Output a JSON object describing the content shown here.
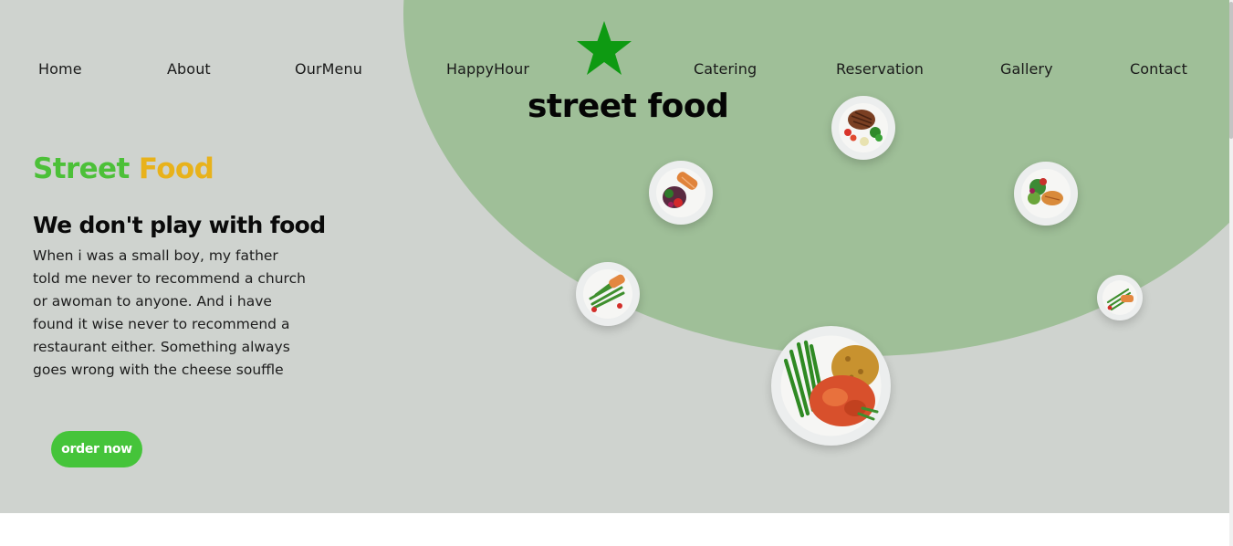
{
  "nav": {
    "items": [
      {
        "label": "Home"
      },
      {
        "label": "About"
      },
      {
        "label": "OurMenu"
      },
      {
        "label": "HappyHour"
      },
      {
        "label": "Catering"
      },
      {
        "label": "Reservation"
      },
      {
        "label": "Gallery"
      },
      {
        "label": "Contact"
      }
    ]
  },
  "brand": {
    "name": "street food",
    "logo_icon": "star-icon",
    "logo_color": "#0e9a12"
  },
  "hero": {
    "headline_part1": "Street",
    "headline_part2": "Food",
    "subheading": "We don't play with food",
    "body": "When i was a small boy, my father told me never to recommend a church or awoman to anyone. And i have found it wise never to recommend a restaurant either. Something always goes wrong with the cheese souffle",
    "cta_label": "order now"
  },
  "colors": {
    "hero_bg": "#cfd3cf",
    "blob": "#9fbf98",
    "accent_green": "#4cc038",
    "accent_orange": "#e8b21b",
    "button": "#45c43a"
  },
  "plates": [
    {
      "name": "steak-plate-image"
    },
    {
      "name": "salmon-salad-plate-image"
    },
    {
      "name": "chicken-salad-plate-image"
    },
    {
      "name": "asparagus-salmon-plate-image"
    },
    {
      "name": "small-salmon-plate-image"
    },
    {
      "name": "chicken-beans-rice-plate-image"
    }
  ]
}
